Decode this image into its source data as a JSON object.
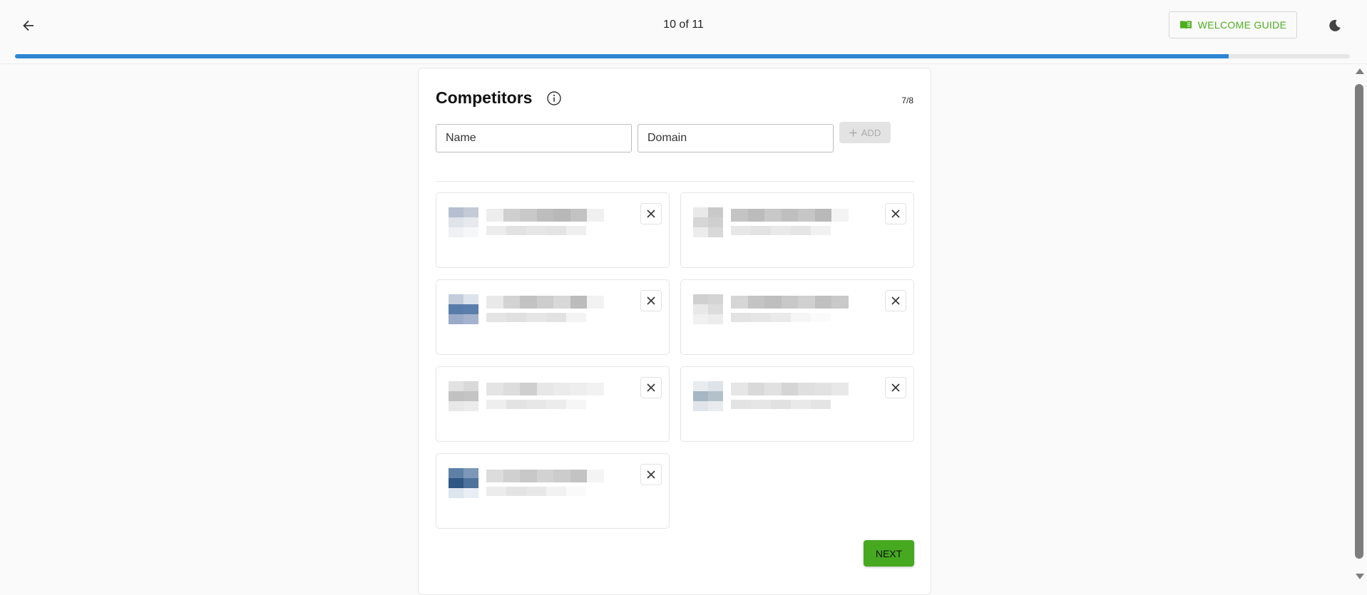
{
  "header": {
    "back_icon": "arrow-left-icon",
    "step_counter": "10 of 11",
    "welcome_guide_label": "WELCOME GUIDE",
    "welcome_guide_icon": "book-icon",
    "theme_icon": "moon-icon",
    "progress_fraction": 0.909,
    "progress_color": "#2e86d3"
  },
  "card": {
    "title": "Competitors",
    "info_icon": "info-icon",
    "count": "7/8",
    "name_placeholder": "Name",
    "domain_placeholder": "Domain",
    "add_label": "ADD",
    "next_label": "NEXT",
    "next_color": "#46a91f"
  },
  "competitors": [
    {
      "logo_colors": [
        "#b6bfcf",
        "#c4cad6",
        "#dfe3ea",
        "#e6e9ee",
        "#eef0f3",
        "#f6f7f9"
      ],
      "name_shades": [
        "#ededed",
        "#cfcfcf",
        "#c9c9c9",
        "#bdbdbd",
        "#b8b8b8",
        "#c2c2c2",
        "#f0f0f0"
      ],
      "domain_shades": [
        "#ececec",
        "#e2e2e2",
        "#e6e6e6",
        "#e4e4e4",
        "#efefef"
      ]
    },
    {
      "logo_colors": [
        "#e9e9e9",
        "#c9c9c9",
        "#d6d6d6",
        "#cfcfcf",
        "#ececec",
        "#d8d8d8"
      ],
      "name_shades": [
        "#c4c4c4",
        "#bcbcbc",
        "#c8c8c8",
        "#bfbfbf",
        "#c6c6c6",
        "#b9b9b9",
        "#f3f3f3"
      ],
      "domain_shades": [
        "#e7e7e7",
        "#e3e3e3",
        "#e9e9e9",
        "#e5e5e5",
        "#f1f1f1"
      ]
    },
    {
      "logo_colors": [
        "#c2ccdb",
        "#dde3ec",
        "#577caa",
        "#5b7fac",
        "#9aaac8",
        "#a4b2ce"
      ],
      "name_shades": [
        "#e9e9e9",
        "#d3d3d3",
        "#c2c2c2",
        "#cdcdcd",
        "#d8d8d8",
        "#bcbcbc",
        "#f2f2f2"
      ],
      "domain_shades": [
        "#e4e4e4",
        "#e0e0e0",
        "#e6e6e6",
        "#e2e2e2",
        "#f3f3f3"
      ]
    },
    {
      "logo_colors": [
        "#d0d0d0",
        "#d4d4d4",
        "#e8e8e8",
        "#dcdcdc",
        "#f0f0f0",
        "#ececec"
      ],
      "name_shades": [
        "#d6d6d6",
        "#c4c4c4",
        "#bebebe",
        "#c8c8c8",
        "#d0d0d0",
        "#c0c0c0",
        "#c9c9c9"
      ],
      "domain_shades": [
        "#e3e3e3",
        "#e6e6e6",
        "#eaeaea",
        "#f6f6f6",
        "#fbfbfb"
      ]
    },
    {
      "logo_colors": [
        "#e2e2e2",
        "#d9d9d9",
        "#c1c1c1",
        "#c4c4c4",
        "#e8e8e8",
        "#ebebeb"
      ],
      "name_shades": [
        "#e4e4e4",
        "#dddddd",
        "#cfcfcf",
        "#e7e7e7",
        "#ebebeb",
        "#eeeeee",
        "#f2f2f2"
      ],
      "domain_shades": [
        "#eeeeee",
        "#e3e3e3",
        "#e7e7e7",
        "#ececec",
        "#f6f6f6"
      ]
    },
    {
      "logo_colors": [
        "#e9ecef",
        "#dde3e8",
        "#a6b6c2",
        "#b3c1cb",
        "#dfe5ea",
        "#e8ecef"
      ],
      "name_shades": [
        "#e6e6e6",
        "#d9d9d9",
        "#e1e1e1",
        "#d5d5d5",
        "#dfdfdf",
        "#e2e2e2",
        "#e8e8e8"
      ],
      "domain_shades": [
        "#e3e3e3",
        "#e6e6e6",
        "#e1e1e1",
        "#e9e9e9",
        "#e4e4e4"
      ]
    },
    {
      "logo_colors": [
        "#5e80a6",
        "#7b98b8",
        "#2f5785",
        "#4e729c",
        "#dde5ee",
        "#e9eef4"
      ],
      "name_shades": [
        "#dcdcdc",
        "#d0d0d0",
        "#c8c8c8",
        "#d2d2d2",
        "#cccccc",
        "#c3c3c3",
        "#f4f4f4"
      ],
      "domain_shades": [
        "#ececec",
        "#e4e4e4",
        "#e7e7e7",
        "#f2f2f2",
        "#fafafa"
      ]
    }
  ]
}
